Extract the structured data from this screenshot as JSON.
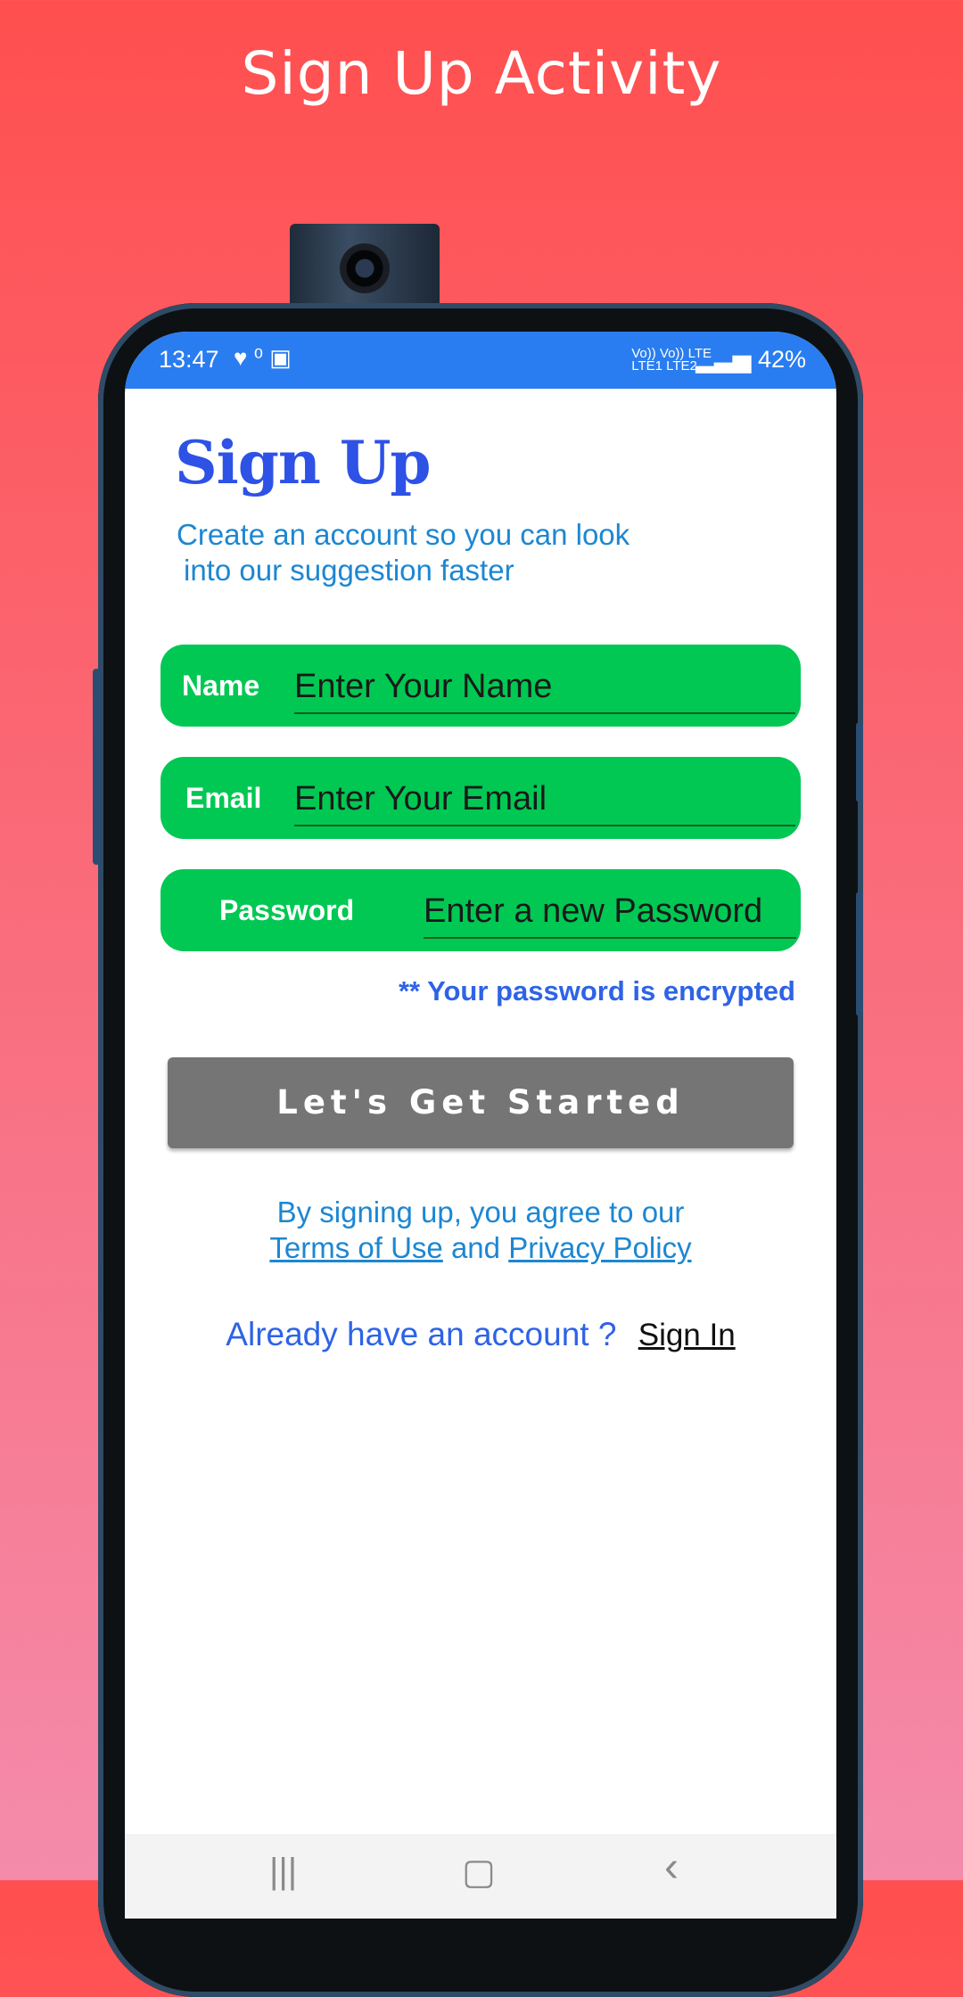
{
  "page": {
    "headline": "Sign Up Activity"
  },
  "status_bar": {
    "time": "13:47",
    "left_icons": "♥ ⁰ ▣",
    "net_line1": "Vo)) Vo)) LTE",
    "net_line2": "LTE1 LTE2",
    "battery": "42%"
  },
  "form": {
    "title": "Sign Up",
    "subtitle_line1": "Create an account so you can look",
    "subtitle_line2": "into our suggestion faster",
    "name_label": "Name",
    "name_placeholder": "Enter Your Name",
    "email_label": "Email",
    "email_placeholder": "Enter Your Email",
    "password_label": "Password",
    "password_placeholder": "Enter a new Password",
    "encrypted_note": "** Your password is encrypted",
    "cta_label": "Let's Get Started",
    "terms_line1": "By signing up, you agree to our",
    "terms_link": "Terms of Use",
    "terms_and": "and",
    "privacy_link": "Privacy Policy",
    "already_text": "Already have an account ?",
    "signin_link": "Sign In"
  },
  "nav": {
    "recents": "|||",
    "home": "▢",
    "back": "‹"
  },
  "colors": {
    "primary": "#2e52e6",
    "field_green": "#00c853",
    "button_gray": "#757575",
    "status_blue": "#2a7df0"
  }
}
